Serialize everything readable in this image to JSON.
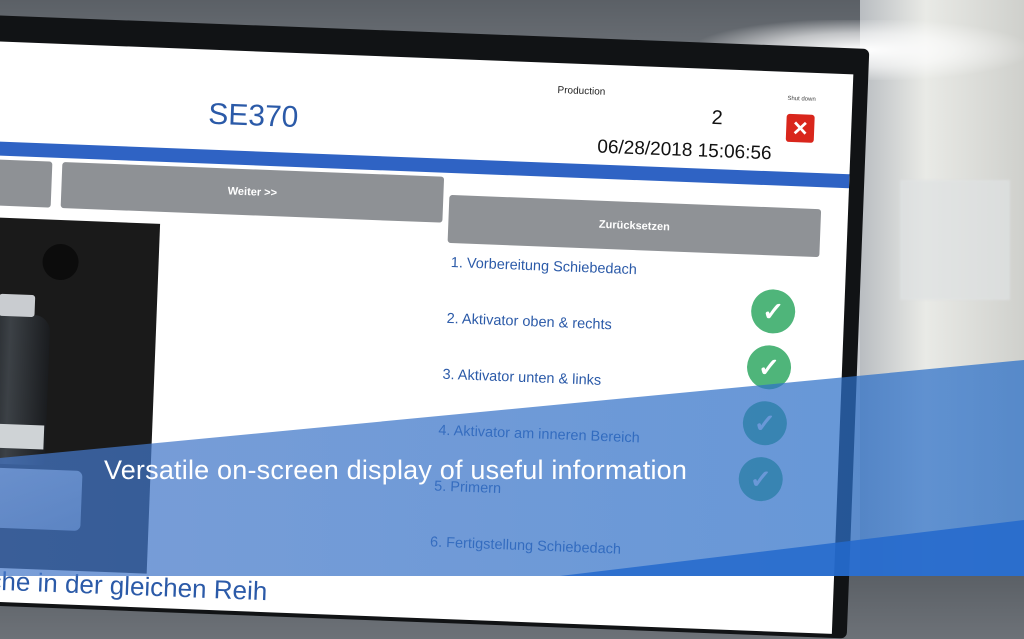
{
  "header": {
    "production_label": "Production",
    "production_count": "2",
    "shutdown_label": "Shut down",
    "close_symbol": "✕",
    "title": "SE370",
    "datetime": "06/28/2018 15:06:56"
  },
  "toolbar": {
    "next_label": "Weiter >>",
    "reset_label": "Zurücksetzen"
  },
  "steps": [
    {
      "label": "1. Vorbereitung Schiebedach"
    },
    {
      "label": "2. Aktivator oben & rechts",
      "done": true
    },
    {
      "label": "3. Aktivator unten & links",
      "done": true
    },
    {
      "label": "4. Aktivator am inneren Bereich",
      "done": true
    },
    {
      "label": "5. Primern",
      "done": true
    },
    {
      "label": "6. Fertigstellung Schiebedach"
    }
  ],
  "check_symbol": "✓",
  "bottom_text": "eiche in der gleichen Reih",
  "caption": "Versatile on-screen display of useful information",
  "colors": {
    "accent_blue": "#2f63c4",
    "title_blue": "#2b5aa8",
    "check_green": "#4fb57a",
    "close_red": "#d9261c",
    "button_gray": "#8e9195"
  }
}
